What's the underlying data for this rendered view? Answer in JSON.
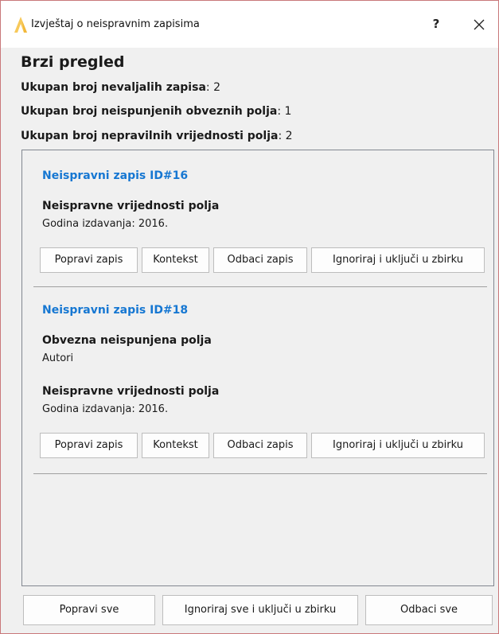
{
  "window": {
    "title": "Izvještaj o neispravnim zapisima",
    "help_label": "?",
    "accent_color": "#1677d2",
    "icons": {
      "app": "app-logo-icon",
      "close": "close-icon"
    }
  },
  "summary": {
    "title": "Brzi pregled",
    "stats": [
      {
        "label": "Ukupan broj nevaljalih zapisa",
        "sep": ": ",
        "value": "2"
      },
      {
        "label": "Ukupan broj neispunjenih obveznih polja",
        "sep": ": ",
        "value": "1"
      },
      {
        "label": "Ukupan broj nepravilnih vrijednosti polja",
        "sep": ": ",
        "value": "2"
      }
    ]
  },
  "records": [
    {
      "title": "Neispravni zapis ID#16",
      "sections": [
        {
          "heading": "Neispravne vrijednosti polja",
          "value": "Godina izdavanja: 2016."
        }
      ],
      "buttons": {
        "fix": "Popravi zapis",
        "context": "Kontekst",
        "discard": "Odbaci zapis",
        "ignore": "Ignoriraj i uključi u zbirku"
      }
    },
    {
      "title": "Neispravni zapis ID#18",
      "sections": [
        {
          "heading": "Obvezna neispunjena polja",
          "value": "Autori"
        },
        {
          "heading": "Neispravne vrijednosti polja",
          "value": "Godina izdavanja: 2016."
        }
      ],
      "buttons": {
        "fix": "Popravi zapis",
        "context": "Kontekst",
        "discard": "Odbaci zapis",
        "ignore": "Ignoriraj i uključi u zbirku"
      }
    }
  ],
  "footer": {
    "fix_all": "Popravi sve",
    "ignore_all": "Ignoriraj sve i uključi u zbirku",
    "discard_all": "Odbaci sve"
  }
}
